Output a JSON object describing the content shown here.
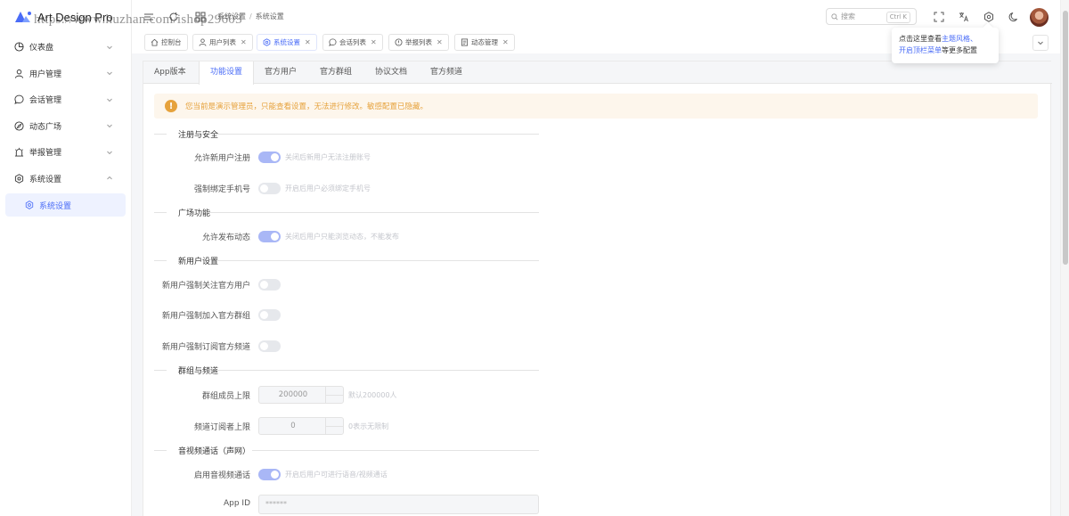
{
  "brand": {
    "name": "Art Design Pro",
    "accent": "#4a6cf7"
  },
  "watermark": "https://www.huzhan.com/ishop29603",
  "sidebar": {
    "items": [
      {
        "label": "仪表盘",
        "icon": "dashboard-icon"
      },
      {
        "label": "用户管理",
        "icon": "user-icon"
      },
      {
        "label": "会话管理",
        "icon": "chat-icon"
      },
      {
        "label": "动态广场",
        "icon": "compass-icon"
      },
      {
        "label": "举报管理",
        "icon": "report-icon"
      },
      {
        "label": "系统设置",
        "icon": "gear-icon"
      }
    ],
    "active_sub": "系统设置"
  },
  "header": {
    "breadcrumb": [
      "系统设置",
      "系统设置"
    ],
    "search_placeholder": "搜索",
    "search_shortcut": "Ctrl K"
  },
  "tabs": [
    {
      "label": "控制台",
      "icon": "home-icon",
      "closable": false
    },
    {
      "label": "用户列表",
      "icon": "users-icon",
      "closable": true
    },
    {
      "label": "系统设置",
      "icon": "gear-icon",
      "closable": true,
      "active": true
    },
    {
      "label": "会话列表",
      "icon": "chat-icon",
      "closable": true
    },
    {
      "label": "举报列表",
      "icon": "alert-icon",
      "closable": true
    },
    {
      "label": "动态管理",
      "icon": "doc-icon",
      "closable": true
    }
  ],
  "tooltip": {
    "p1": "点击这里查看",
    "link1": "主题风格",
    "sep": "、",
    "link2": "开启顶栏菜单",
    "p2": "等更多配置"
  },
  "subtabs": [
    "App版本",
    "功能设置",
    "官方用户",
    "官方群组",
    "协议文档",
    "官方频道"
  ],
  "alert": "您当前是演示管理员，只能查看设置，无法进行修改。敏感配置已隐藏。",
  "sections": {
    "security": {
      "title": "注册与安全",
      "allow_register": {
        "label": "允许新用户注册",
        "on": true,
        "hint": "关闭后新用户无法注册账号"
      },
      "bind_phone": {
        "label": "强制绑定手机号",
        "on": false,
        "hint": "开启后用户必须绑定手机号"
      }
    },
    "square": {
      "title": "广场功能",
      "allow_post": {
        "label": "允许发布动态",
        "on": true,
        "hint": "关闭后用户只能浏览动态，不能发布"
      }
    },
    "newuser": {
      "title": "新用户设置",
      "follow_official": {
        "label": "新用户强制关注官方用户",
        "on": false
      },
      "join_group": {
        "label": "新用户强制加入官方群组",
        "on": false
      },
      "subscribe_channel": {
        "label": "新用户强制订阅官方频道",
        "on": false
      }
    },
    "group": {
      "title": "群组与频道",
      "group_limit": {
        "label": "群组成员上限",
        "value": "200000",
        "hint": "默认200000人"
      },
      "channel_limit": {
        "label": "频道订阅者上限",
        "value": "0",
        "hint": "0表示无限制"
      }
    },
    "rtc": {
      "title": "音视频通话（声网）",
      "enable_rtc": {
        "label": "启用音视频通话",
        "on": true,
        "hint": "开启后用户可进行语音/视频通话"
      },
      "app_id": {
        "label": "App ID",
        "value": "******"
      }
    }
  }
}
